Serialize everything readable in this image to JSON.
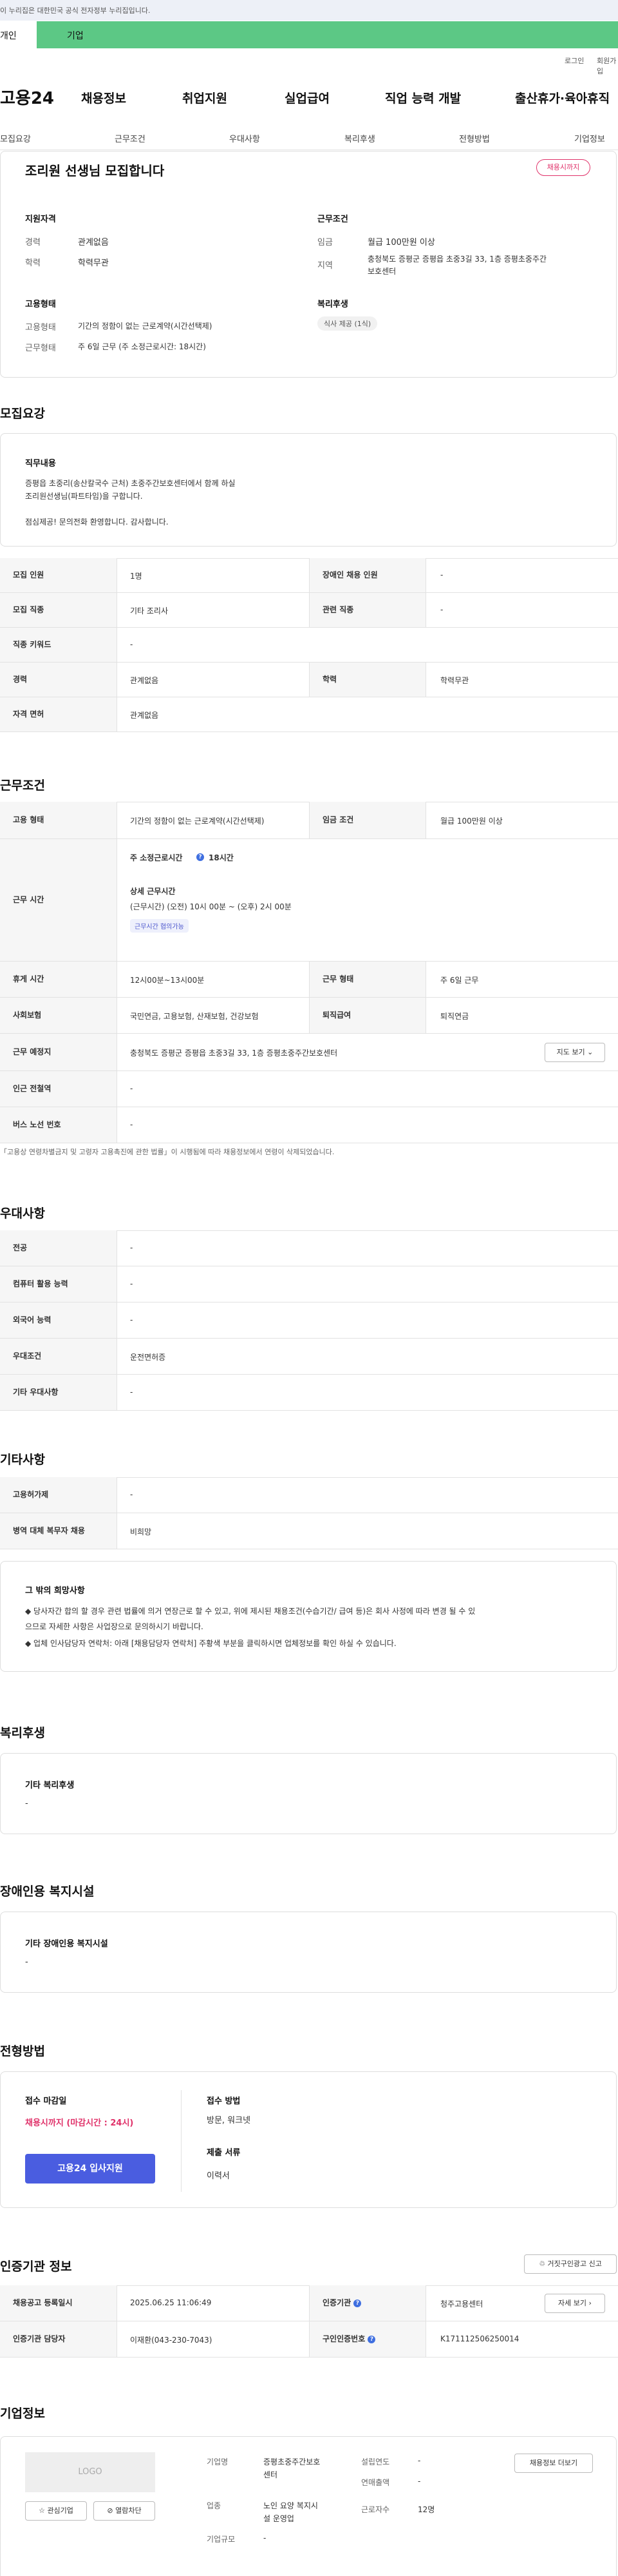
{
  "gov_banner": "이 누리집은 대한민국 공식 전자정부 누리집입니다.",
  "green_row": {
    "left": "개인",
    "right": "기업"
  },
  "util": {
    "login": "로그인",
    "signup": "회원가입"
  },
  "logo": "고용24",
  "gnav": [
    "채용정보",
    "취업지원",
    "실업급여",
    "직업 능력 개발",
    "출산휴가·육아휴직"
  ],
  "subtabs": [
    "모집요강",
    "근무조건",
    "우대사항",
    "복리후생",
    "전형방법",
    "기업정보"
  ],
  "summary": {
    "title": "조리원 선생님 모집합니다",
    "badge": "채용시까지",
    "qual": {
      "heading": "지원자격",
      "career_k": "경력",
      "career_v": "관계없음",
      "edu_k": "학력",
      "edu_v": "학력무관"
    },
    "cond": {
      "heading": "근무조건",
      "wage_k": "임금",
      "wage_v": "월급 100만원 이상",
      "region_k": "지역",
      "region_v1": "충청북도 증평군 증평읍 초중3길 33, 1층 증평초중주간",
      "region_v2": "보호센터"
    },
    "emp": {
      "heading": "고용형태",
      "type_k": "고용형태",
      "type_v": "기간의 정함이 없는 근로계약(시간선택제)",
      "hours_k": "근무형태",
      "hours_v": "주 6일 근무 (주 소정근로시간: 18시간)"
    },
    "welfare": {
      "heading": "복리후생",
      "tag": "식사 제공 (1식)"
    }
  },
  "recruit": {
    "title": "모집요강",
    "duty_heading": "직무내용",
    "duty_lines": [
      "증평읍 초중리(송산칼국수 근처) 초중주간보호센터에서 함께 하실",
      "조리원선생님(파트타임)을 구합니다.",
      "",
      "점심제공! 문의전화 환영합니다. 감사합니다."
    ],
    "rows": [
      {
        "l1": "모집 인원",
        "v1": "1명",
        "l2": "장애인 채용 인원",
        "v2": "-"
      },
      {
        "l1": "모집 직종",
        "v1": "기타 조리사",
        "l2": "관련 직종",
        "v2": "-"
      },
      {
        "l1": "직종 키워드",
        "v1": "-"
      },
      {
        "l1": "경력",
        "v1": "관계없음",
        "l2": "학력",
        "v2": "학력무관"
      },
      {
        "l1": "자격 면허",
        "v1": "관계없음"
      }
    ]
  },
  "work": {
    "title": "근무조건",
    "type_l": "고용 형태",
    "type_v": "기간의 정함이 없는 근로계약(시간선택제)",
    "wage_l": "임금 조건",
    "wage_v": "월급 100만원 이상",
    "time_l": "근무 시간",
    "std_hours": "주 소정근로시간",
    "std_hours_v": "18시간",
    "detail_h": "상세 근무시간",
    "detail_v": "(근무시간) (오전) 10시 00분 ~ (오후) 2시 00분",
    "chip": "근무시간 협의가능",
    "rest_l": "휴게 시간",
    "rest_v": "12시00분~13시00분",
    "form_l": "근무 형태",
    "form_v": "주 6일 근무",
    "ins_l": "사회보험",
    "ins_v": "국민연금, 고용보험, 산재보험, 건강보험",
    "pay_l": "퇴직급여",
    "pay_v": "퇴직연금",
    "loc_l": "근무 예정지",
    "loc_v": "충청북도 증평군 증평읍 초중3길 33, 1층 증평초중주간보호센터",
    "map_btn": "지도 보기",
    "sub_l": "인근 전철역",
    "sub_v": "-",
    "bus_l": "버스 노선 번호",
    "bus_v": "-",
    "note": "「고용상 연령차별금지 및 고령자 고용촉진에 관한 법률」이 시행됨에 따라 채용정보에서 연령이 삭제되었습니다."
  },
  "pref": {
    "title": "우대사항",
    "rows": [
      [
        "전공",
        "-"
      ],
      [
        "컴퓨터 활용 능력",
        "-"
      ],
      [
        "외국어 능력",
        "-"
      ],
      [
        "우대조건",
        "운전면허증"
      ],
      [
        "기타 우대사항",
        "-"
      ]
    ]
  },
  "etc": {
    "title": "기타사항",
    "rows": [
      [
        "고용허가제",
        "-"
      ],
      [
        "병역 대체 복무자 채용",
        "비희망"
      ]
    ],
    "hope_h": "그 밖의 희망사항",
    "hope_lines": [
      "◆ 당사자간 합의 할 경우 관련 법률에 의거 연장근로 할 수 있고, 위에 제시된 채용조건(수습기간/ 급여 등)은 회사 사정에 따라 변경 될 수 있",
      "으므로 자세한 사항은 사업장으로 문의하시기 바랍니다.",
      "◆ 업체 인사담당자 연락처: 아래 [채용담당자 연락처] 주황색 부분을 클릭하시면 업체정보를 확인 하실 수 있습니다."
    ]
  },
  "welfare": {
    "title": "복리후생",
    "h": "기타 복리후생",
    "v": "-"
  },
  "disab": {
    "title": "장애인용 복지시설",
    "h": "기타 장애인용 복지시설",
    "v": "-"
  },
  "process": {
    "title": "전형방법",
    "deadline_h": "접수 마감일",
    "deadline_v": "채용시까지 (마감시간 : 24시)",
    "apply_btn": "고용24 입사지원",
    "method_h": "접수 방법",
    "method_v": "방문, 워크넷",
    "docs_h": "제출 서류",
    "docs_v": "이력서"
  },
  "cert": {
    "title": "인증기관 정보",
    "report_btn": "거짓구인광고 신고",
    "reg_l": "채용공고 등록일시",
    "reg_v": "2025.06.25 11:06:49",
    "org_l": "인증기관",
    "org_v": "청주고용센터",
    "more_btn": "자세 보기",
    "mgr_l": "인증기관 담당자",
    "mgr_v": "이재환(043-230-7043)",
    "num_l": "구인인증번호",
    "num_v": "K171112506250014"
  },
  "company": {
    "title": "기업정보",
    "logo": "LOGO",
    "fav_btn": "관심기업",
    "block_btn": "열람차단",
    "name_k": "기업명",
    "name_v1": "증평초중주간보호",
    "name_v2": "센터",
    "year_k": "설립연도",
    "year_v": "-",
    "sales_k": "연매출액",
    "sales_v": "-",
    "biz_k": "업종",
    "biz_v1": "노인 요양 복지시",
    "biz_v2": "설 운영업",
    "emp_k": "근로자수",
    "emp_v": "12명",
    "size_k": "기업규모",
    "size_v": "-",
    "jobs_btn": "채용정보 더보기"
  }
}
